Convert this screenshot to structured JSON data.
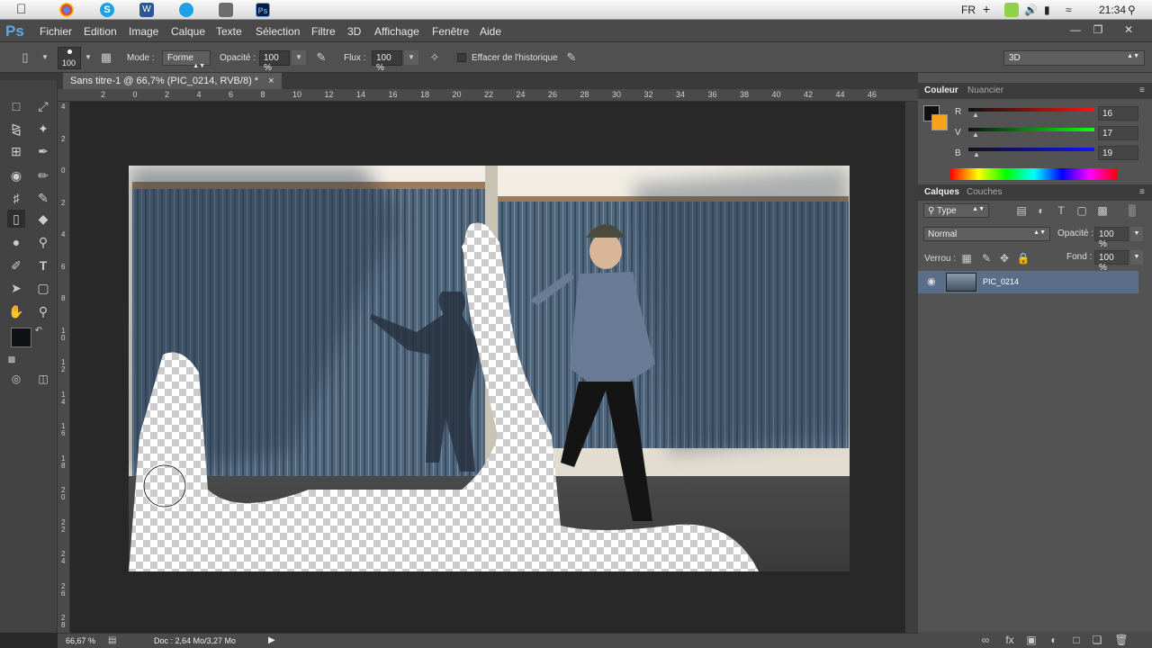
{
  "taskbar": {
    "lang": "FR",
    "clock": "21:34",
    "apps": [
      "apple-icon",
      "chrome-icon",
      "skype-icon",
      "word-icon",
      "refresh-icon",
      "paint-icon",
      "photoshop-icon"
    ]
  },
  "app": {
    "logo": "Ps"
  },
  "menu": [
    "Fichier",
    "Edition",
    "Image",
    "Calque",
    "Texte",
    "Sélection",
    "Filtre",
    "3D",
    "Affichage",
    "Fenêtre",
    "Aide"
  ],
  "options": {
    "brush_size": "100",
    "mode_label": "Mode :",
    "mode_value": "Forme",
    "opacity_label": "Opacité :",
    "opacity_value": "100 %",
    "flow_label": "Flux :",
    "flow_value": "100 %",
    "history_label": "Effacer de l'historique",
    "workspace": "3D"
  },
  "document": {
    "tab": "Sans titre-1 @ 66,7% (PIC_0214, RVB/8) *",
    "zoom": "66,67 %",
    "doc_info": "Doc : 2,64 Mo/3,27 Mo"
  },
  "rulers": {
    "h": [
      "2",
      "0",
      "2",
      "4",
      "6",
      "8",
      "10",
      "12",
      "14",
      "16",
      "18",
      "20",
      "22",
      "24",
      "26",
      "28",
      "30",
      "32",
      "34",
      "36",
      "38",
      "40",
      "42",
      "44",
      "46"
    ],
    "v": [
      "4",
      "2",
      "0",
      "2",
      "4",
      "6",
      "8",
      "1\n0",
      "1\n2",
      "1\n4",
      "1\n6",
      "1\n8",
      "2\n0",
      "2\n2",
      "2\n4",
      "2\n6",
      "2\n8"
    ]
  },
  "color_panel": {
    "tab_active": "Couleur",
    "tab_inactive": "Nuancier",
    "r_label": "R",
    "g_label": "V",
    "b_label": "B",
    "r_value": "16",
    "g_value": "17",
    "b_value": "19",
    "fg": "#101113",
    "bg": "#f7a21b"
  },
  "layers_panel": {
    "tab_active": "Calques",
    "tab_inactive": "Couches",
    "filter": "Type",
    "blend": "Normal",
    "opacity_label": "Opacité :",
    "opacity_value": "100 %",
    "lock_label": "Verrou :",
    "fill_label": "Fond :",
    "fill_value": "100 %",
    "layer_name": "PIC_0214"
  },
  "colors": {
    "accent": "#5fa8e8",
    "selected_layer": "#5a6e8a"
  }
}
